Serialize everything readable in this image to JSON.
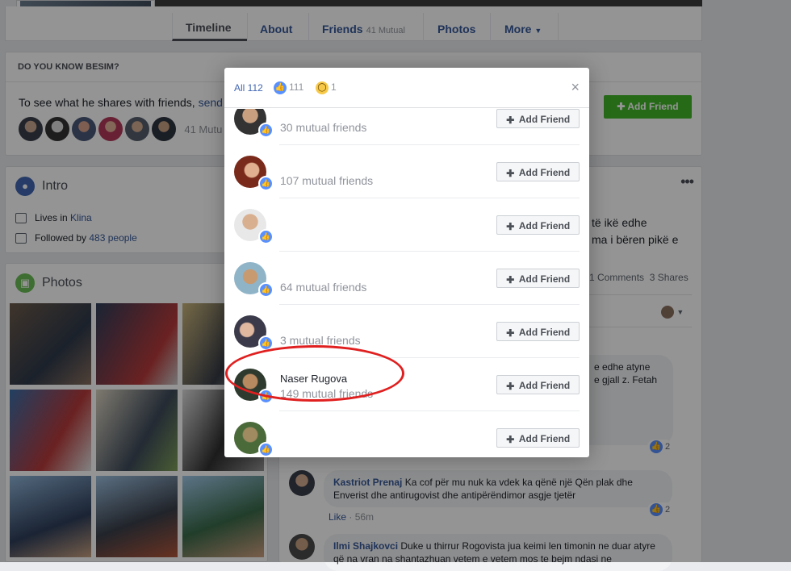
{
  "nav": {
    "tabs": [
      {
        "label": "Timeline"
      },
      {
        "label": "About"
      },
      {
        "label": "Friends",
        "sub": "41 Mutual"
      },
      {
        "label": "Photos"
      },
      {
        "label": "More"
      }
    ]
  },
  "know": {
    "heading": "DO YOU KNOW BESIM?",
    "text": "To see what he shares with friends,",
    "text_link": "send",
    "mutual_partial": "41 Mutu",
    "add_friend": "Add Friend"
  },
  "intro": {
    "title": "Intro",
    "lives_prefix": "Lives in ",
    "lives_place": "Klina",
    "followed_prefix": "Followed by ",
    "followed_count": "483 people"
  },
  "photos": {
    "title": "Photos"
  },
  "feed": {
    "partial_text_1": "të ikë edhe",
    "partial_text_2": "ma i bëren pikë e",
    "stats": "1 Comments  3 Shares",
    "comment1_partial_1": "e edhe atyne",
    "comment1_partial_2": "e gjall z. Fetah",
    "comment1_count": "2",
    "comment2_author": "Kastriot Prenaj",
    "comment2_text": " Ka cof për mu nuk ka vdek ka qënë një Qën plak dhe Enverist dhe antirugovist dhe antipërëndimor asgje tjetër",
    "comment2_like": "Like",
    "comment2_time": "56m",
    "comment2_count": "2",
    "comment3_author": "Ilmi Shajkovci",
    "comment3_text": " Duke u thirrur Rogovista jua keimi len timonin ne duar atyre që na vran na shantazhuan vetem e vetem mos te bejm ndasi ne"
  },
  "modal": {
    "tab_all": "All 112",
    "tab_like": "111",
    "tab_wow": "1",
    "close": "×",
    "add_label": "Add Friend",
    "rows": [
      {
        "name": "",
        "mutual": "30 mutual friends"
      },
      {
        "name": "",
        "mutual": "107 mutual friends"
      },
      {
        "name": "",
        "mutual": ""
      },
      {
        "name": "",
        "mutual": "64 mutual friends"
      },
      {
        "name": "",
        "mutual": "3 mutual friends"
      },
      {
        "name": "Naser Rugova",
        "mutual": "149 mutual friends"
      },
      {
        "name": "",
        "mutual": ""
      }
    ]
  },
  "colors": {
    "accent": "#4267b2",
    "green": "#42b72a",
    "highlight": "#e02020"
  }
}
